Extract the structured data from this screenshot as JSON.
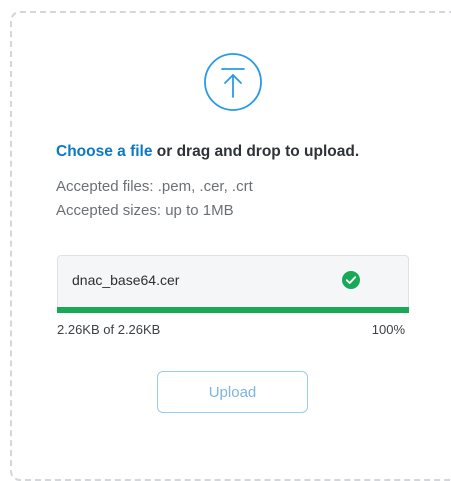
{
  "uploader": {
    "choose_link": "Choose a file",
    "prompt_rest": " or drag and drop to upload.",
    "accepted_types": "Accepted files: .pem, .cer, .crt",
    "accepted_sizes": "Accepted sizes: up to 1MB",
    "upload_icon": "upload-arrow-circle-icon"
  },
  "file": {
    "name": "dnac_base64.cer",
    "status_icon": "check-circle-icon",
    "progress_fraction": 1.0,
    "size_text": "2.26KB of 2.26KB",
    "percent_text": "100%"
  },
  "actions": {
    "upload_label": "Upload"
  },
  "colors": {
    "accent": "#0b79c8",
    "success": "#18a957",
    "icon_blue": "#2a9ae6"
  }
}
